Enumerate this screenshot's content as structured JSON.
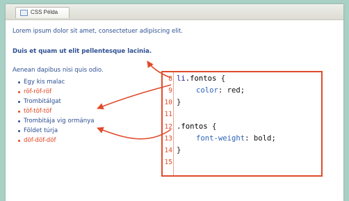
{
  "tab": {
    "label": "CSS Példa",
    "icon": "page-icon"
  },
  "content": {
    "p1": "Lorem ipsum dolor sit amet, consectetuer adipiscing elit.",
    "p2": "Duis et quam ut elit pellentesque lacinia.",
    "p3": "Aenean dapibus nisi quis odio."
  },
  "list": [
    {
      "text": "Egy kis malac",
      "red": false
    },
    {
      "text": "röf-röf-röf",
      "red": true
    },
    {
      "text": "Trombitálgat",
      "red": false
    },
    {
      "text": "töf-töf-töf",
      "red": true
    },
    {
      "text": "Trombitája vig ormánya",
      "red": false
    },
    {
      "text": "Földet túrja",
      "red": false
    },
    {
      "text": "döf-döf-döf",
      "red": true
    }
  ],
  "code": {
    "lines": [
      {
        "n": "8",
        "a": "li",
        "b": ".fontos",
        "c": " {"
      },
      {
        "n": "9",
        "p": "color",
        "v": ": red;"
      },
      {
        "n": "10",
        "t": "}"
      },
      {
        "n": "11",
        "t": ""
      },
      {
        "n": "12",
        "b": ".fontos",
        "c": " {"
      },
      {
        "n": "13",
        "p": "font-weight",
        "v": ": bold;"
      },
      {
        "n": "14",
        "t": "}"
      },
      {
        "n": "15",
        "t": ""
      }
    ]
  },
  "colors": {
    "text": "#2d4f92",
    "accent": "#e04b2a",
    "red_item": "#e2431e"
  }
}
